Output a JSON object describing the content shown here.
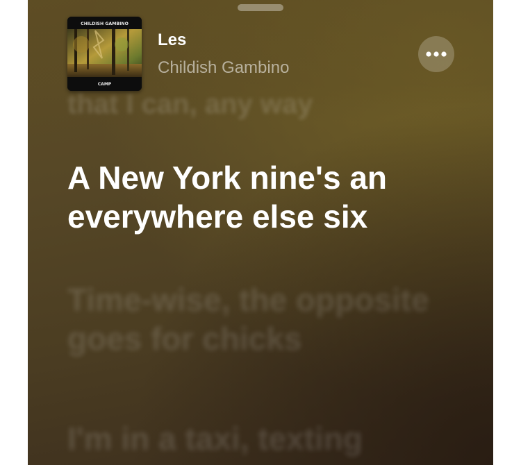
{
  "now_playing": {
    "title": "Les",
    "artist": "Childish Gambino",
    "artwork": {
      "top_text": "CHILDISH GAMBINO",
      "bottom_text": "CAMP"
    }
  },
  "controls": {
    "more_icon": "ellipsis-icon"
  },
  "lyrics": {
    "previous": "that I can, any way",
    "current": "A New York nine's an everywhere else six",
    "next": "Time-wise, the opposite goes for chicks",
    "after": "I'm in a taxi, texting"
  },
  "colors": {
    "background_top": "#5f4e24",
    "background_bottom": "#3b2d1d",
    "lyric_active": "#ffffff"
  }
}
